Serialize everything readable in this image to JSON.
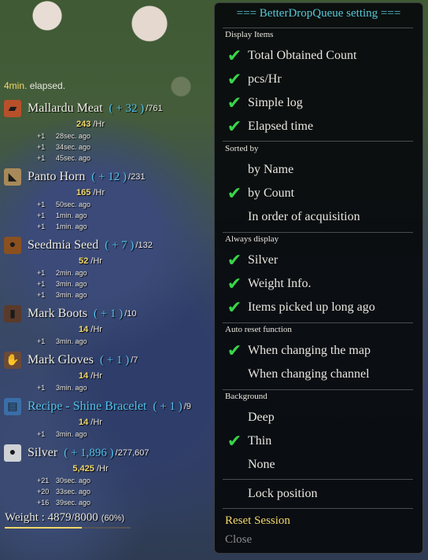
{
  "log": {
    "elapsed_value": "4min.",
    "elapsed_label": "elapsed.",
    "items": [
      {
        "name": "Mallardu Meat",
        "gain": "( + 32 )",
        "total": "/761",
        "rate": "243",
        "rate_unit": " /Hr",
        "entries": [
          {
            "c": "+1",
            "t": "28sec. ago"
          },
          {
            "c": "+1",
            "t": "34sec. ago"
          },
          {
            "c": "+1",
            "t": "45sec. ago"
          }
        ],
        "icon": "meat-icon",
        "color": "#b8502a"
      },
      {
        "name": "Panto Horn",
        "gain": "( + 12 )",
        "total": "/231",
        "rate": "165",
        "rate_unit": " /Hr",
        "entries": [
          {
            "c": "+1",
            "t": "50sec. ago"
          },
          {
            "c": "+1",
            "t": "1min. ago"
          },
          {
            "c": "+1",
            "t": "1min. ago"
          }
        ],
        "icon": "horn-icon",
        "color": "#a88a5a"
      },
      {
        "name": "Seedmia Seed",
        "gain": "( + 7 )",
        "total": "/132",
        "rate": "52",
        "rate_unit": " /Hr",
        "entries": [
          {
            "c": "+1",
            "t": "2min. ago"
          },
          {
            "c": "+1",
            "t": "3min. ago"
          },
          {
            "c": "+1",
            "t": "3min. ago"
          }
        ],
        "icon": "seed-icon",
        "color": "#8a5020"
      },
      {
        "name": "Mark Boots",
        "gain": "( + 1 )",
        "total": "/10",
        "rate": "14",
        "rate_unit": " /Hr",
        "entries": [
          {
            "c": "+1",
            "t": "3min. ago"
          }
        ],
        "icon": "boots-icon",
        "color": "#5a3a2a"
      },
      {
        "name": "Mark Gloves",
        "gain": "( + 1 )",
        "total": "/7",
        "rate": "14",
        "rate_unit": " /Hr",
        "entries": [
          {
            "c": "+1",
            "t": "3min. ago"
          }
        ],
        "icon": "gloves-icon",
        "color": "#6a4a3a"
      },
      {
        "name": "Recipe - Shine Bracelet",
        "gain": "( + 1 )",
        "total": "/9",
        "rate": "14",
        "rate_unit": " /Hr",
        "entries": [
          {
            "c": "+1",
            "t": "3min. ago"
          }
        ],
        "icon": "recipe-icon",
        "color": "#3a6ea8",
        "blue": true
      },
      {
        "name": "Silver",
        "gain": "( + 1,896 )",
        "total": "/277,607",
        "rate": "5,425",
        "rate_unit": " /Hr",
        "entries": [
          {
            "c": "+21",
            "t": "30sec. ago"
          },
          {
            "c": "+20",
            "t": "33sec. ago"
          },
          {
            "c": "+16",
            "t": "39sec. ago"
          }
        ],
        "icon": "silver-coin-icon",
        "color": "#cfd3d6"
      }
    ],
    "weight_label": "Weight : 4879/8000",
    "weight_pct": "(60%)",
    "weight_fraction": 0.61
  },
  "panel": {
    "title": "=== BetterDropQueue setting ===",
    "sections": {
      "display": "Display Items",
      "sorted": "Sorted by",
      "always": "Always display",
      "autoreset": "Auto reset function",
      "background": "Background"
    },
    "options": {
      "total_count": {
        "label": "Total Obtained Count",
        "checked": true
      },
      "pcs_hr": {
        "label": "pcs/Hr",
        "checked": true
      },
      "simple_log": {
        "label": "Simple log",
        "checked": true
      },
      "elapsed_time": {
        "label": "Elapsed time",
        "checked": true
      },
      "by_name": {
        "label": "by Name",
        "checked": false
      },
      "by_count": {
        "label": "by Count",
        "checked": true
      },
      "by_acq": {
        "label": "In order of acquisition",
        "checked": false
      },
      "silver": {
        "label": "Silver",
        "checked": true
      },
      "weight_info": {
        "label": "Weight Info.",
        "checked": true
      },
      "items_long_ago": {
        "label": "Items picked up long ago",
        "checked": true
      },
      "change_map": {
        "label": "When changing the map",
        "checked": true
      },
      "change_channel": {
        "label": "When changing channel",
        "checked": false
      },
      "bg_deep": {
        "label": "Deep",
        "checked": false
      },
      "bg_thin": {
        "label": "Thin",
        "checked": true
      },
      "bg_none": {
        "label": "None",
        "checked": false
      },
      "lock_position": {
        "label": "Lock position",
        "checked": false
      }
    },
    "check_glyph": "✔",
    "reset_label": "Reset Session",
    "close_label": "Close",
    "accent_color": "#59c9d8",
    "check_color": "#39d44a"
  }
}
